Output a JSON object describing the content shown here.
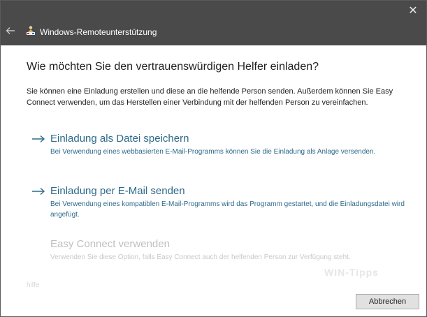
{
  "window": {
    "title": "Windows-Remoteunterstützung",
    "close_glyph": "✕",
    "back_icon": "back-arrow-icon",
    "app_icon": "remote-assistance-icon"
  },
  "main": {
    "heading": "Wie möchten Sie den vertrauenswürdigen Helfer einladen?",
    "intro": "Sie können eine Einladung erstellen und diese an die helfende Person senden. Außerdem können Sie Easy Connect verwenden, um das Herstellen einer Verbindung mit der helfenden Person zu vereinfachen.",
    "options": [
      {
        "title": "Einladung als Datei speichern",
        "description": "Bei Verwendung eines webbasierten E-Mail-Programms können Sie die Einladung als Anlage versenden.",
        "enabled": true
      },
      {
        "title": "Einladung per E-Mail senden",
        "description": "Bei Verwendung eines kompatiblen E-Mail-Programms wird das Programm gestartet, und die Einladungsdatei wird angefügt.",
        "enabled": true
      },
      {
        "title": "Easy Connect verwenden",
        "description": "Verwenden Sie diese Option, falls Easy Connect auch der helfenden Person zur Verfügung steht.",
        "enabled": false
      }
    ],
    "help_link": "hilfe",
    "watermark": "WIN-Tipps"
  },
  "footer": {
    "cancel_label": "Abbrechen"
  },
  "colors": {
    "titlebar": "#4a4a4a",
    "link": "#2d6a8a",
    "disabled": "#bfbfbf"
  }
}
